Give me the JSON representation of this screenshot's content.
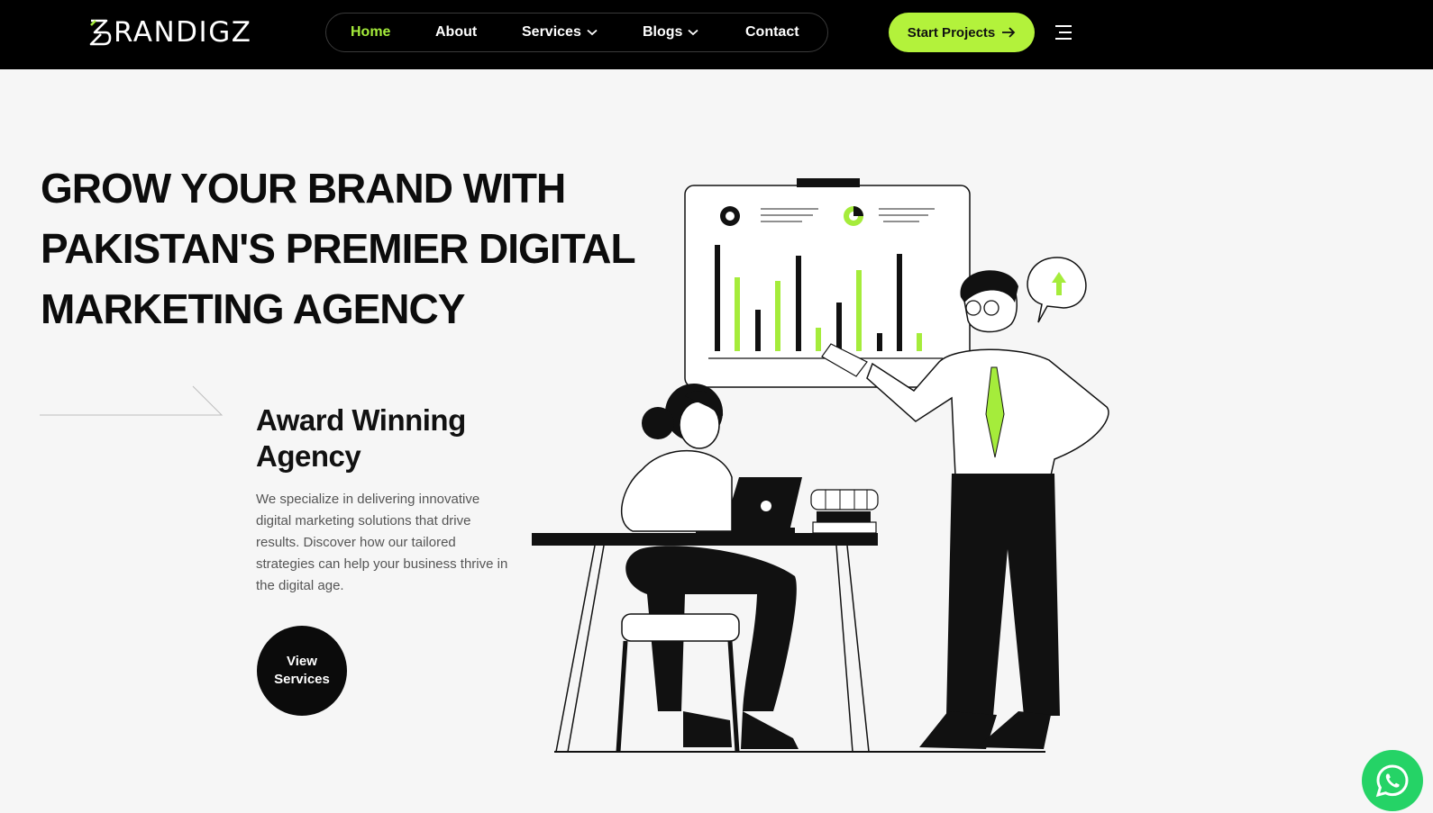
{
  "header": {
    "logo_text": "RANDIGZ",
    "logo_letter": "B",
    "nav": [
      {
        "label": "Home",
        "active": true
      },
      {
        "label": "About"
      },
      {
        "label": "Services",
        "dropdown": true
      },
      {
        "label": "Blogs",
        "dropdown": true
      },
      {
        "label": "Contact"
      }
    ],
    "cta_label": "Start Projects",
    "cta_icon": "arrow-right-icon",
    "menu_icon": "hamburger-menu-icon"
  },
  "hero": {
    "title_lines": [
      "GROW YOUR BRAND WITH",
      "PAKISTAN'S PREMIER DIGITAL",
      "MARKETING AGENCY"
    ],
    "award_lines": [
      "Award Winning",
      "Agency"
    ],
    "description": "We specialize in delivering innovative digital marketing solutions that drive results. Discover how our tailored strategies can help your business thrive in the digital age.",
    "button_lines": [
      "View",
      "Services"
    ]
  },
  "floating": {
    "whatsapp_icon": "whatsapp-icon"
  },
  "colors": {
    "accent": "#b3f23b",
    "nav_active": "#a5ec3b",
    "background": "#f6f6f6",
    "header_bg": "#000000",
    "whatsapp": "#25d366"
  }
}
